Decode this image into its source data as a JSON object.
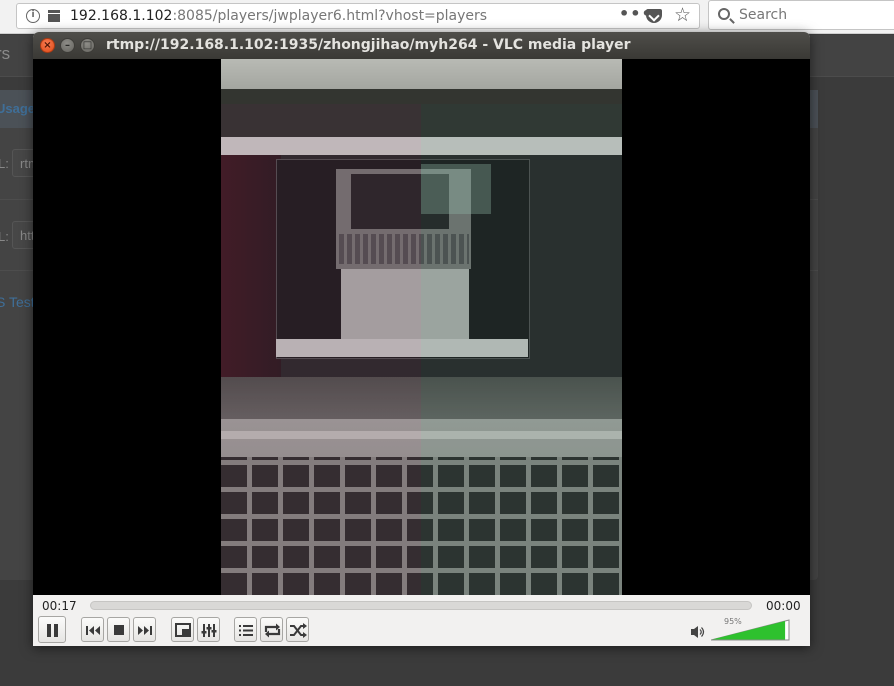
{
  "browser": {
    "url_host": "192.168.1.102",
    "url_rest": ":8085/players/jwplayer6.html?vhost=players",
    "more_label": "•••",
    "star_label": "☆",
    "search_placeholder": "Search"
  },
  "page": {
    "brand": "rs",
    "usage": "Usage",
    "rows": [
      {
        "label": "L:",
        "value": "rtm"
      },
      {
        "label": "L:",
        "value": "htt"
      }
    ],
    "test_link": "S Test"
  },
  "vlc": {
    "title": "rtmp://192.168.1.102:1935/zhongjihao/myh264 - VLC media player",
    "close_label": "×",
    "minimize_label": "–",
    "maximize_label": "□",
    "elapsed": "00:17",
    "total": "00:00",
    "seek_progress": 0,
    "volume_percent": 95,
    "volume_label": "95%",
    "colors": {
      "titlebar": "#3c3b37",
      "close": "#e95420",
      "volume_fill": "#2ec12e",
      "controls_bg": "#f2f1f0"
    },
    "buttons": [
      "pause-icon",
      "previous-icon",
      "stop-icon",
      "next-icon",
      "fullscreen-icon",
      "equalizer-icon",
      "playlist-icon",
      "loop-icon",
      "shuffle-icon"
    ]
  }
}
